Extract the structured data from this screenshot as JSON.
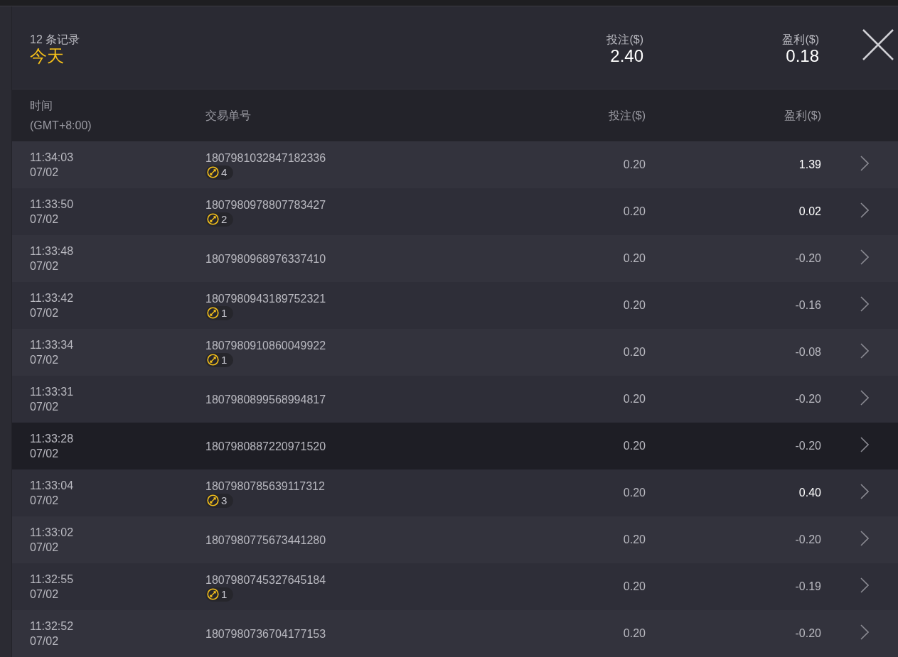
{
  "summary": {
    "count_label": "12 条记录",
    "period": "今天",
    "stake_label": "投注($)",
    "stake_total": "2.40",
    "profit_label": "盈利($)",
    "profit_total": "0.18"
  },
  "table": {
    "columns": [
      {
        "lines": [
          "时间",
          "(GMT+8:00)"
        ]
      },
      {
        "lines": [
          "交易单号"
        ]
      },
      {
        "lines": [
          "投注($)"
        ]
      },
      {
        "lines": [
          "盈利($)"
        ]
      }
    ],
    "rows": [
      {
        "time": "11:34:03",
        "date": "07/02",
        "order_id": "1807981032847182336",
        "badge": "4",
        "stake": "0.20",
        "profit": "1.39",
        "win": true,
        "selected": false
      },
      {
        "time": "11:33:50",
        "date": "07/02",
        "order_id": "1807980978807783427",
        "badge": "2",
        "stake": "0.20",
        "profit": "0.02",
        "win": true,
        "selected": false
      },
      {
        "time": "11:33:48",
        "date": "07/02",
        "order_id": "1807980968976337410",
        "stake": "0.20",
        "profit": "-0.20",
        "win": false,
        "selected": false
      },
      {
        "time": "11:33:42",
        "date": "07/02",
        "order_id": "1807980943189752321",
        "badge": "1",
        "stake": "0.20",
        "profit": "-0.16",
        "win": false,
        "selected": false
      },
      {
        "time": "11:33:34",
        "date": "07/02",
        "order_id": "1807980910860049922",
        "badge": "1",
        "stake": "0.20",
        "profit": "-0.08",
        "win": false,
        "selected": false
      },
      {
        "time": "11:33:31",
        "date": "07/02",
        "order_id": "1807980899568994817",
        "stake": "0.20",
        "profit": "-0.20",
        "win": false,
        "selected": false
      },
      {
        "time": "11:33:28",
        "date": "07/02",
        "order_id": "1807980887220971520",
        "stake": "0.20",
        "profit": "-0.20",
        "win": false,
        "selected": true
      },
      {
        "time": "11:33:04",
        "date": "07/02",
        "order_id": "1807980785639117312",
        "badge": "3",
        "stake": "0.20",
        "profit": "0.40",
        "win": true,
        "selected": false
      },
      {
        "time": "11:33:02",
        "date": "07/02",
        "order_id": "1807980775673441280",
        "stake": "0.20",
        "profit": "-0.20",
        "win": false,
        "selected": false
      },
      {
        "time": "11:32:55",
        "date": "07/02",
        "order_id": "1807980745327645184",
        "badge": "1",
        "stake": "0.20",
        "profit": "-0.19",
        "win": false,
        "selected": false
      },
      {
        "time": "11:32:52",
        "date": "07/02",
        "order_id": "1807980736704177153",
        "stake": "0.20",
        "profit": "-0.20",
        "win": false,
        "selected": false
      }
    ]
  }
}
